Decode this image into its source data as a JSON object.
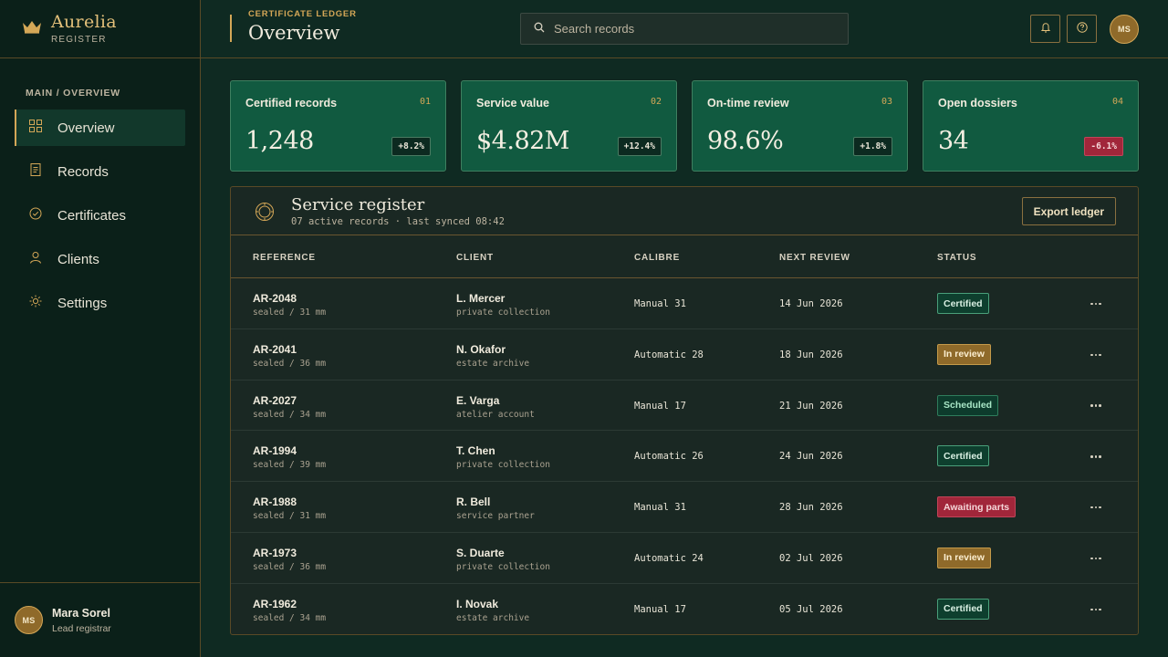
{
  "brand": {
    "name": "Aurelia",
    "sub": "REGISTER"
  },
  "breadcrumb": "MAIN / OVERVIEW",
  "nav": [
    {
      "label": "Overview",
      "icon": "grid-icon",
      "active": true
    },
    {
      "label": "Records",
      "icon": "document-icon",
      "active": false
    },
    {
      "label": "Certificates",
      "icon": "check-circle-icon",
      "active": false
    },
    {
      "label": "Clients",
      "icon": "person-icon",
      "active": false
    },
    {
      "label": "Settings",
      "icon": "gear-icon",
      "active": false
    }
  ],
  "user": {
    "initials": "MS",
    "name": "Mara Sorel",
    "role": "Lead registrar"
  },
  "header": {
    "eyebrow": "CERTIFICATE LEDGER",
    "title": "Overview",
    "search_placeholder": "Search records",
    "avatar_initials": "MS"
  },
  "kpis": [
    {
      "label": "Certified records",
      "index": "01",
      "value": "1,248",
      "delta": "+8.2%",
      "negative": false
    },
    {
      "label": "Service value",
      "index": "02",
      "value": "$4.82M",
      "delta": "+12.4%",
      "negative": false
    },
    {
      "label": "On-time review",
      "index": "03",
      "value": "98.6%",
      "delta": "+1.8%",
      "negative": false
    },
    {
      "label": "Open dossiers",
      "index": "04",
      "value": "34",
      "delta": "-6.1%",
      "negative": true
    }
  ],
  "register": {
    "title": "Service register",
    "subtitle": "07 active records · last synced 08:42",
    "export_label": "Export ledger",
    "columns": [
      "REFERENCE",
      "CLIENT",
      "CALIBRE",
      "NEXT REVIEW",
      "STATUS"
    ],
    "rows": [
      {
        "ref": "AR-2048",
        "ref_sub": "sealed / 31 mm",
        "client": "L. Mercer",
        "client_sub": "private collection",
        "calibre": "Manual 31",
        "review": "14 Jun 2026",
        "status": "Certified",
        "status_type": "cert"
      },
      {
        "ref": "AR-2041",
        "ref_sub": "sealed / 36 mm",
        "client": "N. Okafor",
        "client_sub": "estate archive",
        "calibre": "Automatic 28",
        "review": "18 Jun 2026",
        "status": "In review",
        "status_type": "rev"
      },
      {
        "ref": "AR-2027",
        "ref_sub": "sealed / 34 mm",
        "client": "E. Varga",
        "client_sub": "atelier account",
        "calibre": "Manual 17",
        "review": "21 Jun 2026",
        "status": "Scheduled",
        "status_type": "sched"
      },
      {
        "ref": "AR-1994",
        "ref_sub": "sealed / 39 mm",
        "client": "T. Chen",
        "client_sub": "private collection",
        "calibre": "Automatic 26",
        "review": "24 Jun 2026",
        "status": "Certified",
        "status_type": "cert"
      },
      {
        "ref": "AR-1988",
        "ref_sub": "sealed / 31 mm",
        "client": "R. Bell",
        "client_sub": "service partner",
        "calibre": "Manual 31",
        "review": "28 Jun 2026",
        "status": "Awaiting parts",
        "status_type": "await"
      },
      {
        "ref": "AR-1973",
        "ref_sub": "sealed / 36 mm",
        "client": "S. Duarte",
        "client_sub": "private collection",
        "calibre": "Automatic 24",
        "review": "02 Jul 2026",
        "status": "In review",
        "status_type": "rev"
      },
      {
        "ref": "AR-1962",
        "ref_sub": "sealed / 34 mm",
        "client": "I. Novak",
        "client_sub": "estate archive",
        "calibre": "Manual 17",
        "review": "05 Jul 2026",
        "status": "Certified",
        "status_type": "cert"
      }
    ]
  },
  "colors": {
    "accent": "#d4a757",
    "panel": "#1a2823",
    "card": "#115a40",
    "alert": "#a1263a"
  }
}
